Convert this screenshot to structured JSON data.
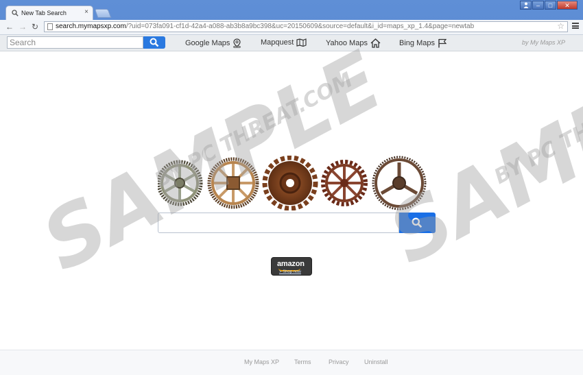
{
  "browser": {
    "tab_title": "New Tab Search",
    "tab_close": "×",
    "url_host": "search.mymapsxp.com",
    "url_rest": "/?uid=073fa091-cf1d-42a4-a088-ab3b8a9bc398&uc=20150609&source=default&i_id=maps_xp_1.4&page=newtab",
    "star": "☆",
    "window_controls": {
      "user": "👤",
      "minimize": "–",
      "maximize": "□",
      "close": "✕"
    },
    "nav": {
      "back": "←",
      "forward": "→",
      "reload": "↻"
    }
  },
  "extension": {
    "search_placeholder": "Search",
    "links": [
      {
        "label": "Google Maps",
        "icon": "map-pin-icon"
      },
      {
        "label": "Mapquest",
        "icon": "folded-map-icon"
      },
      {
        "label": "Yahoo Maps",
        "icon": "home-icon"
      },
      {
        "label": "Bing Maps",
        "icon": "flag-icon"
      }
    ],
    "brand": "by My Maps XP"
  },
  "main": {
    "search_value": "",
    "amazon_logo": "amazon",
    "amazon_shop": "> Shop now"
  },
  "footer": {
    "links": [
      "My Maps XP",
      "Terms",
      "Privacy",
      "Uninstall"
    ]
  },
  "watermark": {
    "left_big": "SAMPLE",
    "left_small": "BY PC THREAT.COM",
    "right_big": "SAMPLE",
    "right_small": "BY PC THREAT.COM"
  },
  "colors": {
    "accent_blue": "#1a6fe6",
    "toolbar_search_blue": "#2a79e0",
    "chrome_frame": "#3d6cc0"
  }
}
